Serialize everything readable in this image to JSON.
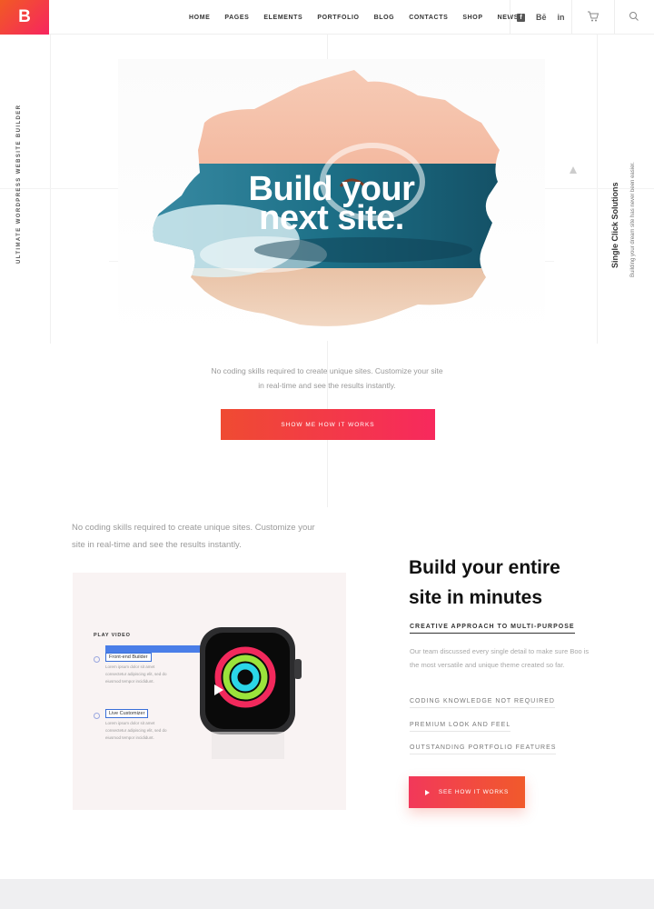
{
  "header": {
    "logo": "B",
    "nav": [
      "HOME",
      "PAGES",
      "ELEMENTS",
      "PORTFOLIO",
      "BLOG",
      "CONTACTS",
      "SHOP",
      "NEWS"
    ],
    "social": [
      "f",
      "Bē",
      "in"
    ]
  },
  "side": {
    "left": "ULTIMATE WORDPRESS WEBSITE BUILDER",
    "right_title": "Single Click Solutions",
    "right_sub": "Building your dream site has never been easier."
  },
  "hero": {
    "title_line1": "Build your",
    "title_line2": "next site.",
    "desc_line1": "No coding skills required to create unique sites. Customize your site",
    "desc_line2": "in real-time and see the results instantly.",
    "button": "SHOW ME HOW IT WORKS"
  },
  "section2": {
    "desc_line1": "No coding skills required to create unique sites. Customize your",
    "desc_line2": "site in real-time and see the results instantly.",
    "video": {
      "play_label": "PLAY VIDEO",
      "feature1": "Front-end Builder",
      "feature2": "Live Customizer",
      "body": "Lorem ipsum dolor sit amet consectetur adipiscing elit, sed do eiusmod tempor incididunt."
    },
    "title_line1": "Build your entire",
    "title_line2": "site in minutes",
    "creative": "CREATIVE APPROACH TO MULTI-PURPOSE",
    "body": "Our team discussed every single detail to make sure Boo is the most versatile and unique theme created so far.",
    "links": [
      "CODING KNOWLEDGE NOT REQUIRED",
      "PREMIUM LOOK AND FEEL",
      "OUTSTANDING PORTFOLIO FEATURES"
    ],
    "button": "SEE HOW IT WORKS"
  },
  "colors": {
    "accent1": "#f15a24",
    "accent2": "#f7255f",
    "ocean": "#1c6f86",
    "sky": "#f6c9b5"
  }
}
